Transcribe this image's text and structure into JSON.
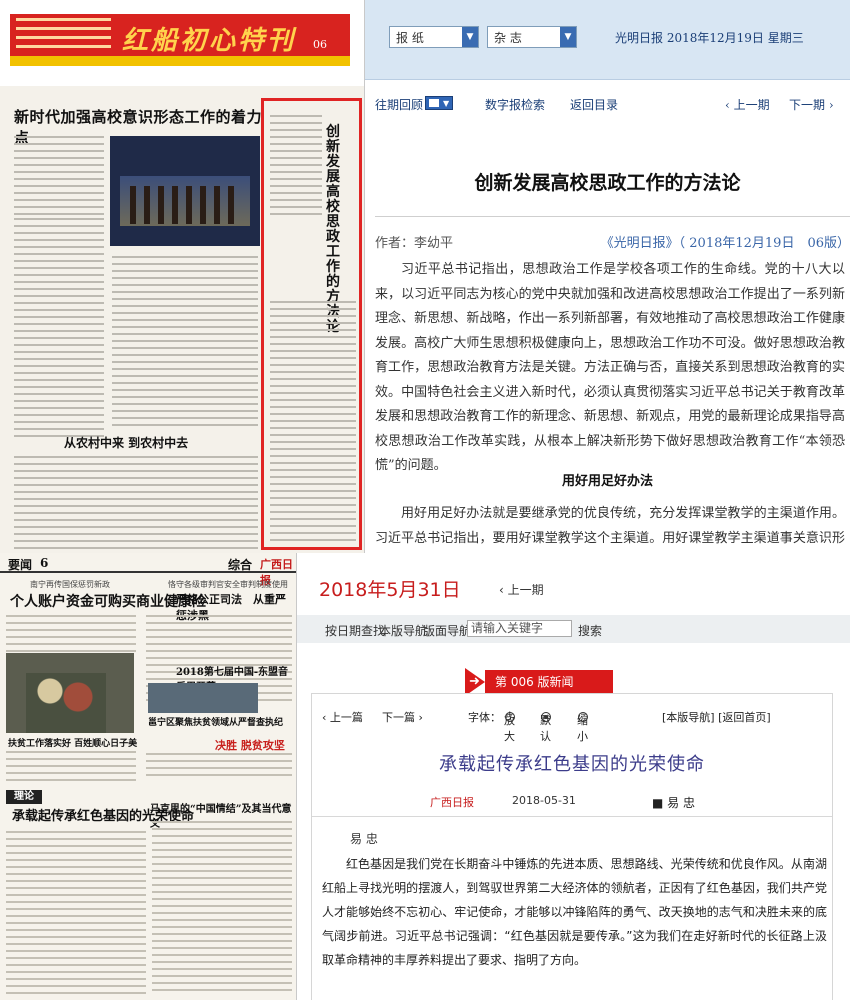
{
  "top_left_paper": {
    "banner_title": "红船初心特刊",
    "page_number": "06",
    "main_headline": "新时代加强高校意识形态工作的着力点",
    "vertical_title": "创新发展高校思政工作的方法论",
    "mid_headline": "从农村中来 到农村中去"
  },
  "top_panel": {
    "selects": [
      {
        "value": "报 纸"
      },
      {
        "value": "杂 志"
      }
    ],
    "date_line": "光明日报 2018年12月19日 星期三",
    "nav": {
      "back_issues": "往期回顾",
      "digital_search": "数字报检索",
      "back_to_toc": "返回目录",
      "prev_page": "‹ 上一期",
      "next_page": "下一期 ›"
    },
    "article": {
      "title": "创新发展高校思政工作的方法论",
      "author": "作者：李幼平",
      "source": "《光明日报》（ 2018年12月19日　06版）",
      "paragraph1": "习近平总书记指出，思想政治工作是学校各项工作的生命线。党的十八大以来，以习近平同志为核心的党中央就加强和改进高校思想政治工作提出了一系列新理念、新思想、新战略，作出一系列新部署，有效地推动了高校思想政治工作健康发展。高校广大师生思想积极健康向上，思想政治工作功不可没。做好思想政治教育工作，思想政治教育方法是关键。方法正确与否，直接关系到思想政治教育的实效。中国特色社会主义进入新时代，必须认真贯彻落实习近平总书记关于教育改革发展和思想政治教育工作的新理念、新思想、新观点，用党的最新理论成果指导高校思想政治工作改革实践，从根本上解决新形势下做好思想政治教育工作“本领恐慌”的问题。",
      "subheading": "用好用足好办法",
      "paragraph2": "用好用足好办法就是要继承党的优良传统，充分发挥课堂教学的主渠道作用。习近平总书记指出，要用好课堂教学这个主渠道。用好课堂教学主渠道事关意识形态工"
    }
  },
  "bottom_left_paper": {
    "section": "要闻",
    "page_number": "6",
    "section_right": "综合",
    "logo": "广西日报",
    "small_head": "南宁再传国保惩罚新政",
    "big_headline": "个人账户资金可购买商业健康险",
    "right_small": "恪守各级审判官安全审判制度使用",
    "right_big": "严格公正司法　从重严惩涉黑",
    "music_headline": "2018第七届中国-东盟音乐周开幕",
    "village_headline": "扶贫工作落实好 百姓顺心日子美",
    "poverty_headline": "邕宁区聚焦扶贫领域从严督查执纪",
    "fight_tag": "决胜 脱贫攻坚",
    "theory_tag": "理论",
    "thumb_title": "承载起传承红色基因的光荣使命",
    "marx_headline": "马克思的“中国情结”及其当代意义"
  },
  "bottom_panel": {
    "date": "2018年5月31日",
    "prev_issue": "‹ 上一期",
    "toolbar": {
      "by_date": "按日期查找",
      "edition_nav": "本版导航",
      "layout_nav": "版面导航",
      "search_placeholder": "请输入关键字",
      "search_button": "搜索"
    },
    "page_label": "第 006 版新闻",
    "article_nav": {
      "prev": "‹ 上一篇",
      "next": "下一篇 ›",
      "font_label": "字体：",
      "enlarge": "放大",
      "default": "默认",
      "shrink": "缩小",
      "links": "[本版导航] [返回首页]"
    },
    "article": {
      "title": "承载起传承红色基因的光荣使命",
      "source": "广西日报",
      "date": "2018-05-31",
      "author": "■ 易 忠",
      "author2": "易 忠",
      "body": "红色基因是我们党在长期奋斗中锤炼的先进本质、思想路线、光荣传统和优良作风。从南湖红船上寻找光明的摆渡人，到驾驭世界第二大经济体的领航者，正因有了红色基因，我们共产党人才能够始终不忘初心、牢记使命，才能够以冲锋陷阵的勇气、改天换地的志气和决胜未来的底气阔步前进。习近平总书记强调：“红色基因就是要传承。”这为我们在走好新时代的长征路上汲取革命精神的丰厚养料提出了要求、指明了方向。"
    }
  }
}
